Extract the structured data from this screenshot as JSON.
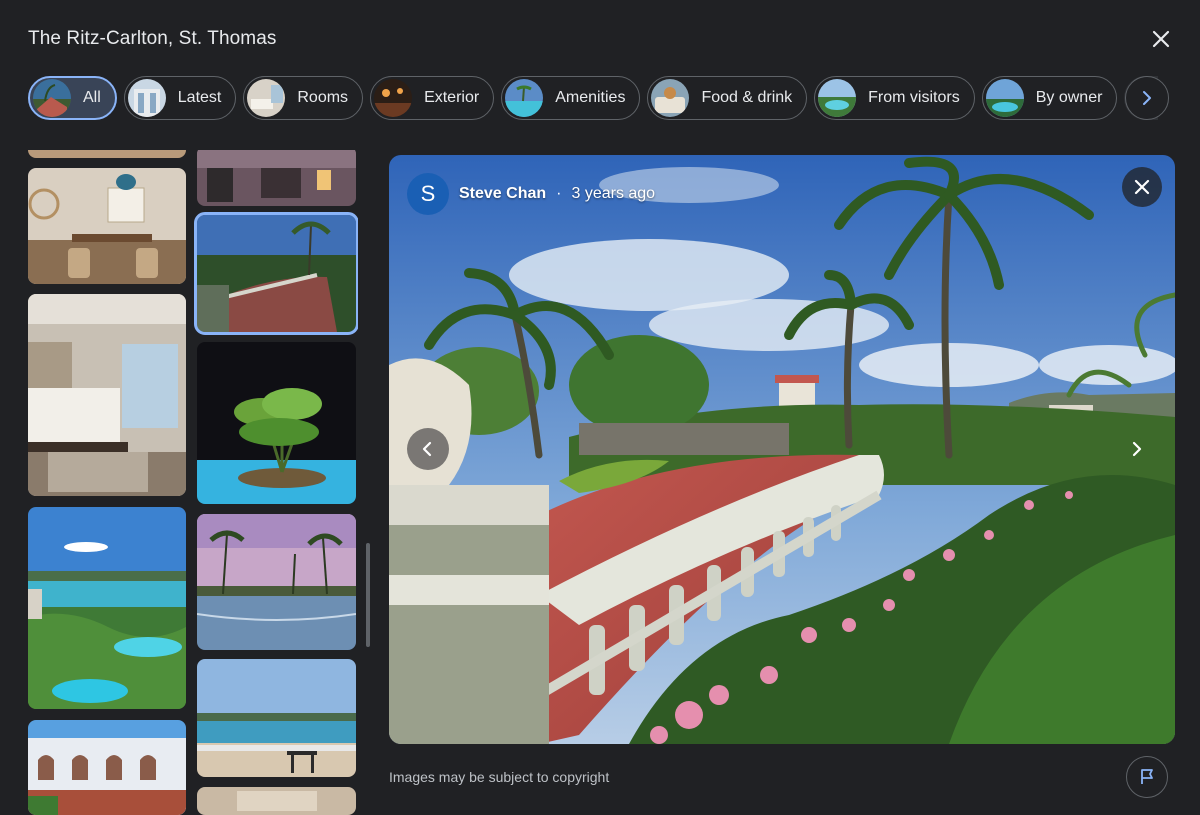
{
  "header": {
    "title": "The Ritz-Carlton, St. Thomas"
  },
  "chips": [
    {
      "label": "All",
      "active": true
    },
    {
      "label": "Latest"
    },
    {
      "label": "Rooms"
    },
    {
      "label": "Exterior"
    },
    {
      "label": "Amenities"
    },
    {
      "label": "Food & drink"
    },
    {
      "label": "From visitors"
    },
    {
      "label": "By owner"
    }
  ],
  "viewer": {
    "author_initial": "S",
    "author_name": "Steve Chan",
    "separator": "·",
    "time_ago": "3 years ago"
  },
  "footer": {
    "copyright": "Images may be subject to copyright"
  },
  "colors": {
    "accent": "#8ab4f8",
    "background": "#202124",
    "chip_active_bg": "#394457",
    "avatar_bg": "#1a5fb4"
  },
  "icons": {
    "close": "close-icon",
    "next": "chevron-right-icon",
    "prev": "chevron-left-icon",
    "flag": "flag-icon"
  }
}
